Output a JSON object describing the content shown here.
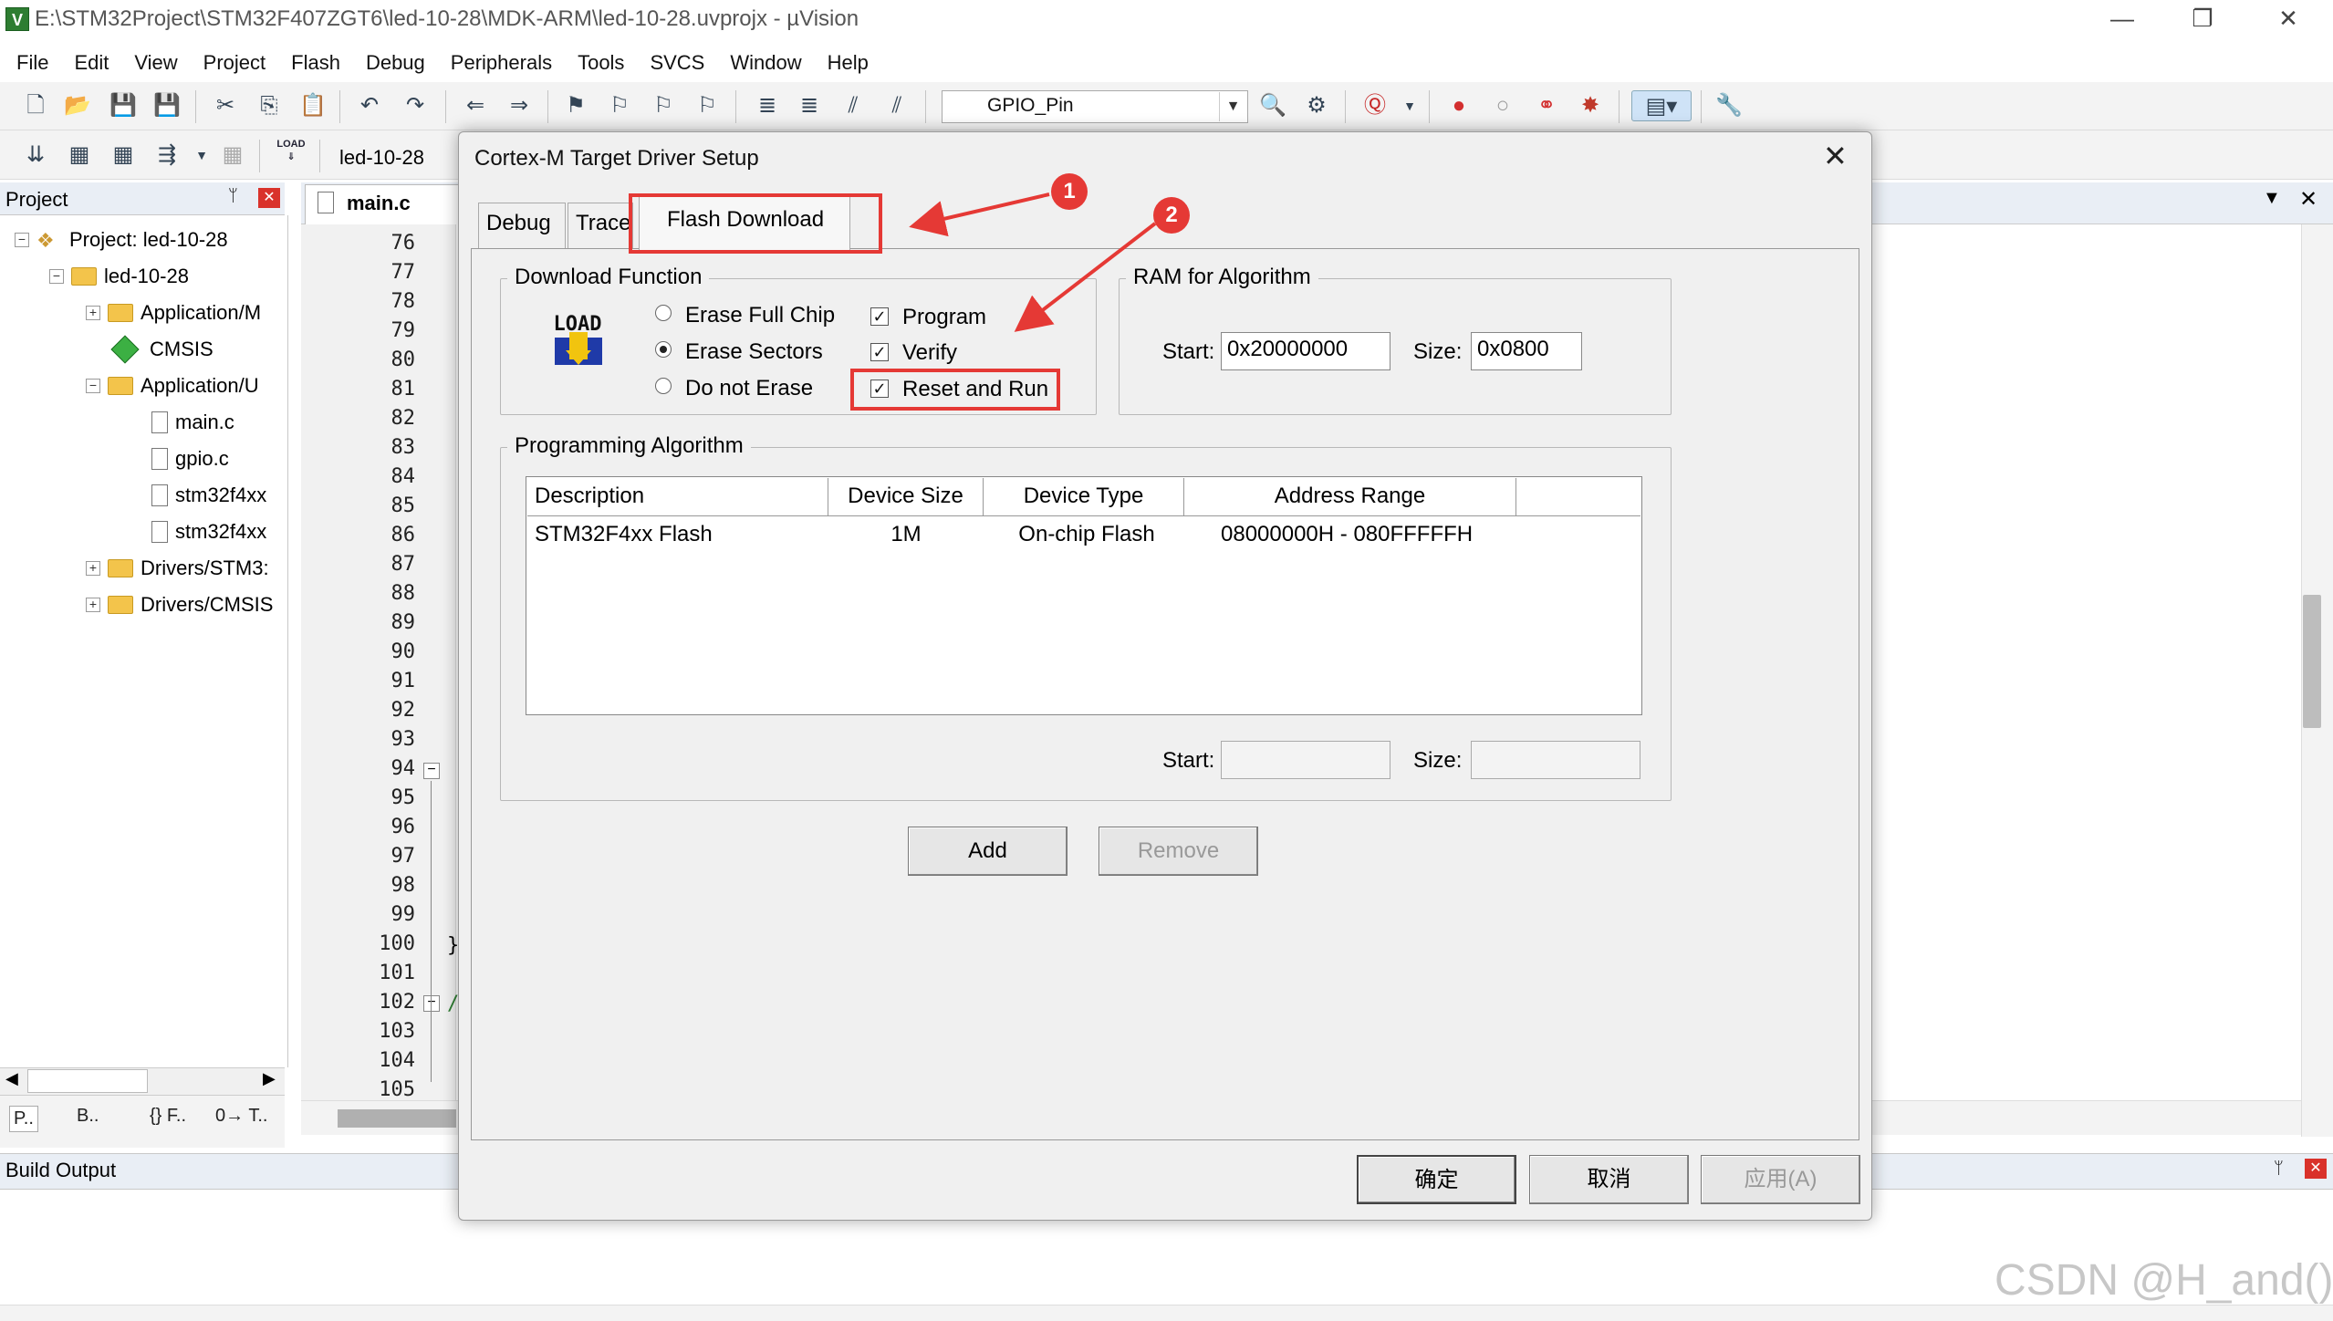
{
  "window": {
    "title": "E:\\STM32Project\\STM32F407ZGT6\\led-10-28\\MDK-ARM\\led-10-28.uvprojx - µVision",
    "app_icon_letter": "V",
    "min_glyph": "—",
    "restore_glyph": "❐",
    "close_glyph": "✕"
  },
  "menu": [
    "File",
    "Edit",
    "View",
    "Project",
    "Flash",
    "Debug",
    "Peripherals",
    "Tools",
    "SVCS",
    "Window",
    "Help"
  ],
  "toolbar": {
    "target": "GPIO_Pin",
    "project_combo": "led-10-28",
    "load_icon_text": "LOAD"
  },
  "project_panel": {
    "title": "Project",
    "pin_glyph": "ᛘ",
    "close_glyph": "✕",
    "tree": [
      {
        "label": "Project: led-10-28",
        "expander": "−"
      },
      {
        "label": "led-10-28",
        "expander": "−"
      },
      {
        "label": "Application/M",
        "expander": "+"
      },
      {
        "label": "CMSIS",
        "expander": ""
      },
      {
        "label": "Application/U",
        "expander": "−"
      },
      {
        "label": "main.c",
        "expander": ""
      },
      {
        "label": "gpio.c",
        "expander": ""
      },
      {
        "label": "stm32f4xx",
        "expander": ""
      },
      {
        "label": "stm32f4xx",
        "expander": ""
      },
      {
        "label": "Drivers/STM3:",
        "expander": "+"
      },
      {
        "label": "Drivers/CMSIS",
        "expander": "+"
      }
    ],
    "tabs": [
      "P..",
      "B..",
      "{} F..",
      "0→ T.."
    ],
    "scroll_left": "◀",
    "scroll_right": "▶"
  },
  "editor": {
    "tab_label": "main.c",
    "dropdown_glyph": "▼",
    "close_glyph": "✕",
    "line_numbers": [
      "76",
      "77",
      "78",
      "79",
      "80",
      "81",
      "82",
      "83",
      "84",
      "85",
      "86",
      "87",
      "88",
      "89",
      "90",
      "91",
      "92",
      "93",
      "94",
      "95",
      "96",
      "97",
      "98",
      "99",
      "100",
      "101",
      "102",
      "103",
      "104",
      "105"
    ],
    "code_fragments": {
      "line_100": "}",
      "line_102": "/"
    }
  },
  "build_output": {
    "title": "Build Output",
    "pin_glyph": "ᛘ",
    "close_glyph": "✕"
  },
  "watermark": "CSDN @H_and()",
  "dialog": {
    "title": "Cortex-M Target Driver Setup",
    "close_glyph": "✕",
    "tabs": [
      "Debug",
      "Trace",
      "Flash Download"
    ],
    "active_tab": "Flash Download",
    "download_function": {
      "label": "Download Function",
      "erase_options": [
        {
          "label": "Erase Full Chip",
          "selected": false
        },
        {
          "label": "Erase Sectors",
          "selected": true
        },
        {
          "label": "Do not Erase",
          "selected": false
        }
      ],
      "checks": [
        {
          "label": "Program",
          "checked": true
        },
        {
          "label": "Verify",
          "checked": true
        },
        {
          "label": "Reset and Run",
          "checked": true
        }
      ],
      "check_glyph": "✓"
    },
    "ram_for_algorithm": {
      "label": "RAM for Algorithm",
      "start_label": "Start:",
      "start_value": "0x20000000",
      "size_label": "Size:",
      "size_value": "0x0800"
    },
    "programming_algorithm": {
      "label": "Programming Algorithm",
      "columns": [
        "Description",
        "Device Size",
        "Device Type",
        "Address Range"
      ],
      "rows": [
        {
          "description": "STM32F4xx Flash",
          "device_size": "1M",
          "device_type": "On-chip Flash",
          "address_range": "08000000H - 080FFFFFH"
        }
      ],
      "start_label": "Start:",
      "start_value": "",
      "size_label": "Size:",
      "size_value": ""
    },
    "buttons": {
      "add": "Add",
      "remove": "Remove",
      "ok": "确定",
      "cancel": "取消",
      "apply": "应用(A)"
    }
  },
  "annotations": {
    "badge_1": "1",
    "badge_2": "2",
    "color": "#e53935"
  }
}
